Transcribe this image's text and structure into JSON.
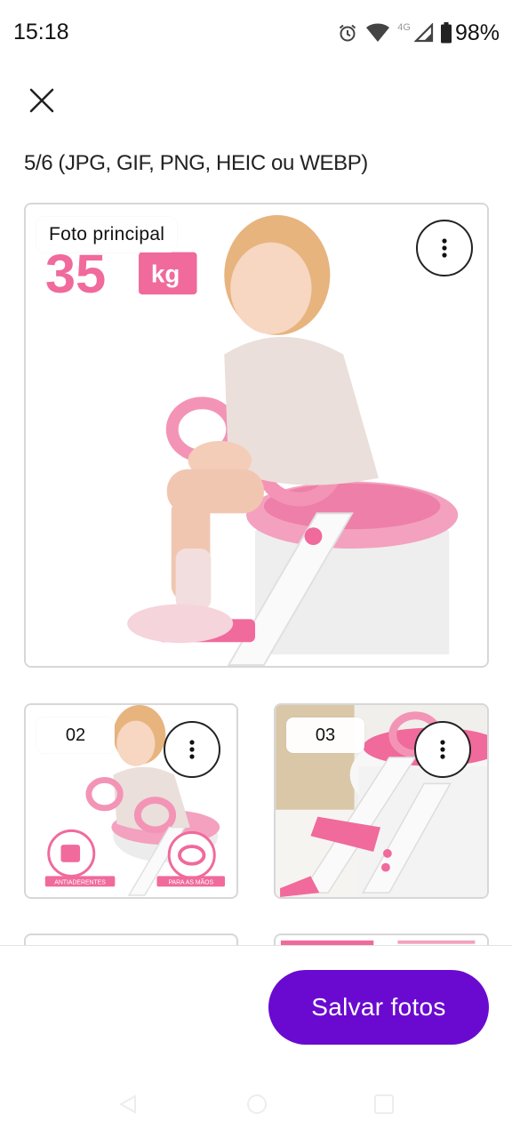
{
  "status_bar": {
    "time": "15:18",
    "network": "4G",
    "battery": "98%",
    "icons": [
      "alarm-icon",
      "wifi-icon",
      "cell-signal-icon",
      "battery-icon"
    ]
  },
  "header": {
    "close_icon": "close-icon",
    "photo_count": "5/6 (JPG, GIF, PNG, HEIC ou WEBP)"
  },
  "photos": {
    "main": {
      "label": "Foto principal",
      "image_text": "35",
      "image_unit": "kg",
      "more_icon": "more-vertical-icon"
    },
    "thumbs": [
      {
        "number": "02",
        "caption_left": "ANTIADERENTES",
        "caption_right": "PARA AS MÃOS"
      },
      {
        "number": "03"
      }
    ]
  },
  "actions": {
    "save_label": "Salvar fotos"
  },
  "colors": {
    "accent": "#6a0ad0",
    "product_pink": "#f06a9c",
    "card_border": "#d7d7d7"
  }
}
